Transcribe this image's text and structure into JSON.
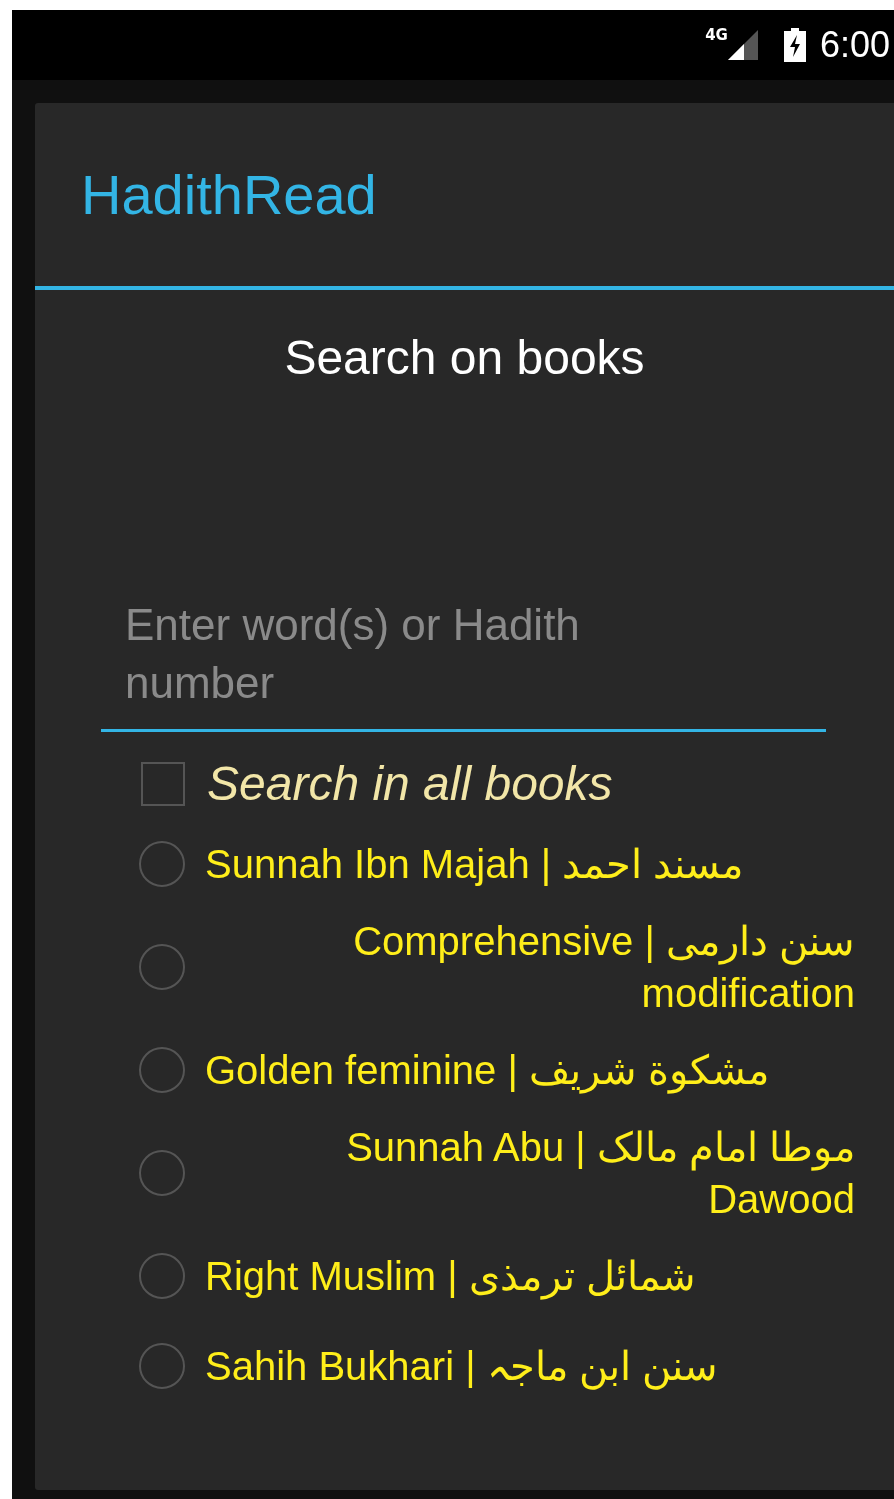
{
  "status_bar": {
    "network": "4G",
    "time": "6:00"
  },
  "dialog": {
    "title": "HadithRead",
    "heading": "Search on books",
    "search": {
      "placeholder": "Enter word(s) or Hadith number"
    },
    "all_books": {
      "label": "Search in all books",
      "checked": false
    },
    "books": [
      {
        "label": "مسند احمد | Sunnah Ibn Majah",
        "selected": false
      },
      {
        "label": "سنن دارمی | Comprehensive modification",
        "selected": false
      },
      {
        "label": "مشکوة شريف | Golden feminine",
        "selected": false
      },
      {
        "label": "موطا امام مالک | Sunnah Abu Dawood",
        "selected": false
      },
      {
        "label": "شمائل ترمذی | Right Muslim",
        "selected": false
      },
      {
        "label": "سنن ابن ماجہ | Sahih Bukhari",
        "selected": false
      }
    ]
  }
}
